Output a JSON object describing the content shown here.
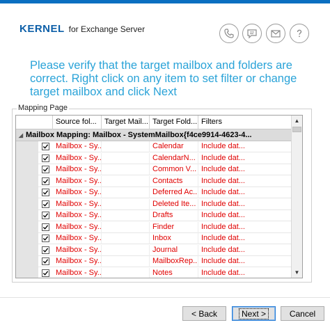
{
  "branding": {
    "brand": "KERNEL",
    "product": "for Exchange Server"
  },
  "header_icons": [
    {
      "name": "phone-icon"
    },
    {
      "name": "chat-icon"
    },
    {
      "name": "mail-icon"
    },
    {
      "name": "help-icon"
    }
  ],
  "instruction": "Please verify that the target mailbox and folders are correct. Right click on any item to set filter or change target mailbox and click Next",
  "mapping": {
    "group_label": "Mapping Page",
    "columns": [
      "Source fol...",
      "Target Mail...",
      "Target Fold...",
      "Filters"
    ],
    "group_row": "Mailbox Mapping: Mailbox - SystemMailbox{f4ce9914-4623-4...",
    "rows": [
      {
        "source": "Mailbox - Sy...",
        "target_mailbox": "",
        "target_folder": "Calendar",
        "filters": "Include dat..."
      },
      {
        "source": "Mailbox - Sy...",
        "target_mailbox": "",
        "target_folder": "CalendarN...",
        "filters": "Include dat..."
      },
      {
        "source": "Mailbox - Sy...",
        "target_mailbox": "",
        "target_folder": "Common V...",
        "filters": "Include dat..."
      },
      {
        "source": "Mailbox - Sy...",
        "target_mailbox": "",
        "target_folder": "Contacts",
        "filters": "Include dat..."
      },
      {
        "source": "Mailbox - Sy...",
        "target_mailbox": "",
        "target_folder": "Deferred Ac...",
        "filters": "Include dat..."
      },
      {
        "source": "Mailbox - Sy...",
        "target_mailbox": "",
        "target_folder": "Deleted Ite...",
        "filters": "Include dat..."
      },
      {
        "source": "Mailbox - Sy...",
        "target_mailbox": "",
        "target_folder": "Drafts",
        "filters": "Include dat..."
      },
      {
        "source": "Mailbox - Sy...",
        "target_mailbox": "",
        "target_folder": "Finder",
        "filters": "Include dat..."
      },
      {
        "source": "Mailbox - Sy...",
        "target_mailbox": "",
        "target_folder": "Inbox",
        "filters": "Include dat..."
      },
      {
        "source": "Mailbox - Sy...",
        "target_mailbox": "",
        "target_folder": "Journal",
        "filters": "Include dat..."
      },
      {
        "source": "Mailbox - Sy...",
        "target_mailbox": "",
        "target_folder": "MailboxRep...",
        "filters": "Include dat..."
      },
      {
        "source": "Mailbox - Sy...",
        "target_mailbox": "",
        "target_folder": "Notes",
        "filters": "Include dat..."
      }
    ]
  },
  "buttons": {
    "back": "< Back",
    "next": "Next >",
    "cancel": "Cancel"
  },
  "colors": {
    "accent": "#2aa3d8",
    "brand": "#0d5fa8",
    "row_text": "#e00000"
  }
}
